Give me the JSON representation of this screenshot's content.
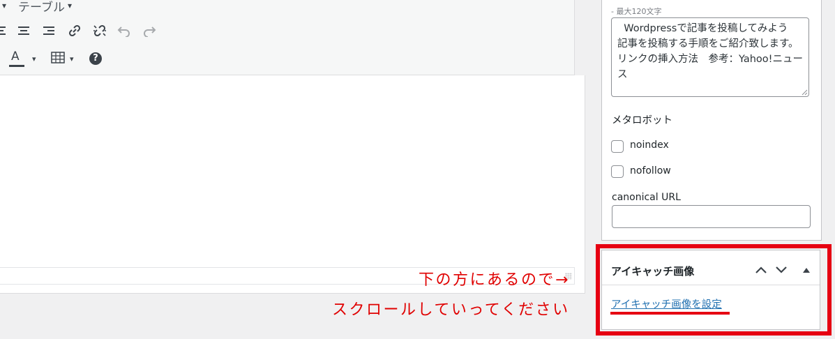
{
  "editor": {
    "toolbar_row1": {
      "caret": "▾",
      "table_label": "テーブル",
      "table_caret": "▾"
    },
    "toolbar_row2_icons": [
      "align-left-icon",
      "align-center-icon",
      "align-right-icon",
      "link-icon",
      "unlink-icon",
      "undo-icon",
      "redo-icon"
    ],
    "toolbar_row3": {
      "text_color_label": "A",
      "text_color_caret": "▾",
      "table_caret": "▾",
      "help_label": "?"
    }
  },
  "annotations": {
    "line1": "下の方にあるので→",
    "line2": "スクロールしていってください"
  },
  "seo": {
    "description_hint": "- 最大120文字",
    "description_value": "  Wordpressで記事を投稿してみよう　記事を投稿する手順をご紹介致します。　リンクの挿入方法　参考：Yahoo!ニュース",
    "meta_robots_label": "メタロボット",
    "noindex_label": "noindex",
    "nofollow_label": "nofollow",
    "canonical_label": "canonical URL",
    "canonical_value": ""
  },
  "featured_image": {
    "title": "アイキャッチ画像",
    "set_link": "アイキャッチ画像を設定",
    "controls": [
      "move-up-icon",
      "move-down-icon",
      "toggle-panel-icon"
    ]
  },
  "colors": {
    "annotation_red": "#e60012",
    "link_blue": "#2271b1"
  }
}
